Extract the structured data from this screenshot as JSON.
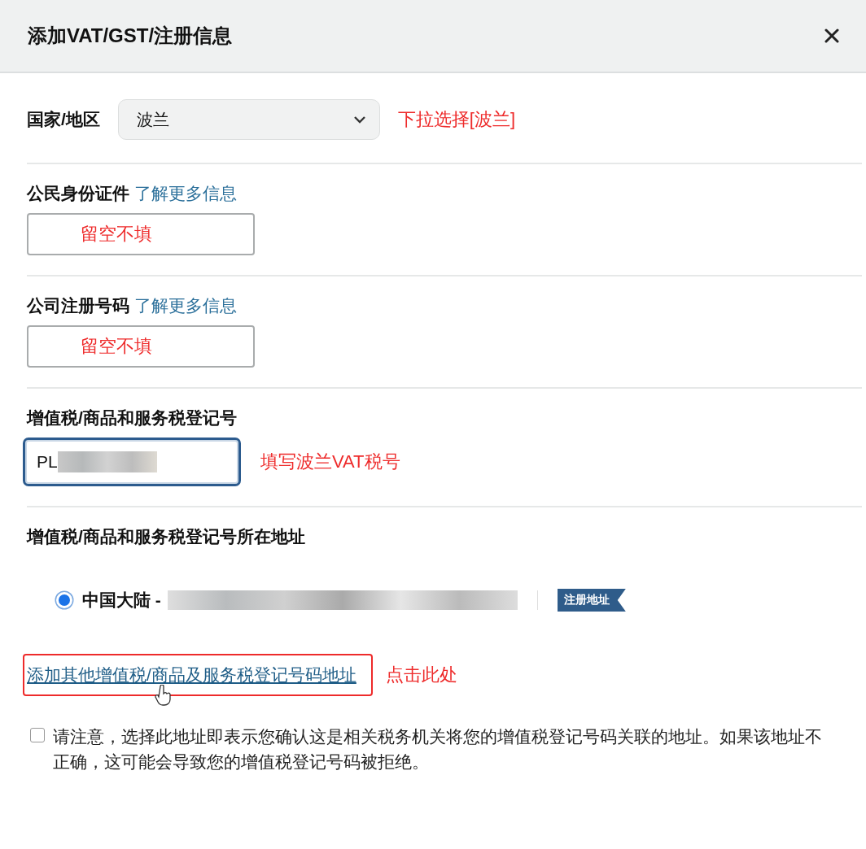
{
  "dialog": {
    "title": "添加VAT/GST/注册信息"
  },
  "country": {
    "label": "国家/地区",
    "value": "波兰",
    "note": "下拉选择[波兰]"
  },
  "fields": [
    {
      "label": "公民身份证件",
      "link": "了解更多信息",
      "note": "留空不填",
      "focused": false
    },
    {
      "label": "公司注册号码",
      "link": "了解更多信息",
      "note": "留空不填",
      "focused": false
    },
    {
      "label": "增值税/商品和服务税登记号",
      "value": "PL",
      "redacted": true,
      "note": "填写波兰VAT税号",
      "focused": true
    }
  ],
  "address": {
    "label": "增值税/商品和服务税登记号所在地址",
    "options": [
      {
        "label": "中国大陆 -",
        "selected": true,
        "redacted": true,
        "badge": "注册地址"
      }
    ]
  },
  "add_link": {
    "text": "添加其他增值税/商品及服务税登记号码地址",
    "note": "点击此处"
  },
  "confirm": {
    "checked": false,
    "text": "请注意，选择此地址即表示您确认这是相关税务机关将您的增值税登记号码关联的地址。如果该地址不正确，这可能会导致您的增值税登记号码被拒绝。"
  }
}
